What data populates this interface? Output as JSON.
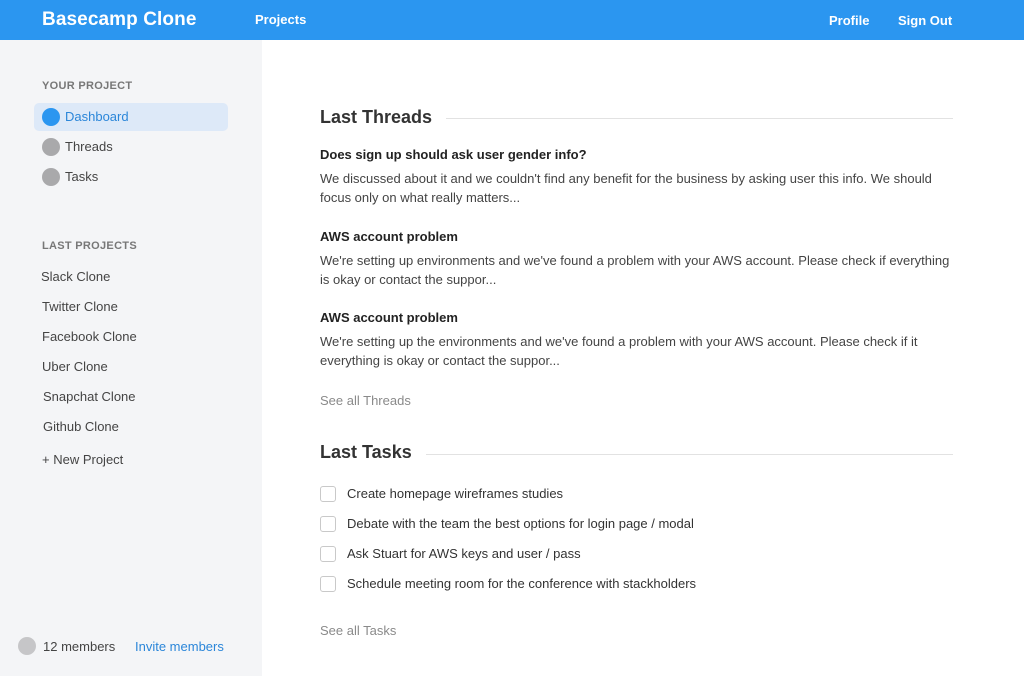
{
  "header": {
    "brand": "Basecamp Clone",
    "projects_label": "Projects",
    "profile_label": "Profile",
    "signout_label": "Sign Out",
    "accent_color": "#2b96f0"
  },
  "sidebar": {
    "your_project_heading": "YOUR PROJECT",
    "nav": [
      {
        "label": "Dashboard",
        "active": true
      },
      {
        "label": "Threads",
        "active": false
      },
      {
        "label": "Tasks",
        "active": false
      }
    ],
    "last_projects_heading": "LAST PROJECTS",
    "projects": [
      "Slack Clone",
      "Twitter Clone",
      "Facebook Clone",
      "Uber Clone",
      "Snapchat Clone",
      "Github Clone"
    ],
    "new_project_label": "+ New Project",
    "members_count": "12 members",
    "invite_label": "Invite members"
  },
  "threads": {
    "title": "Last Threads",
    "items": [
      {
        "title": "Does sign up should ask user gender info?",
        "body": "We discussed about it and we couldn't find any benefit for the business by asking user this info. We should focus only on what really matters..."
      },
      {
        "title": "AWS account problem",
        "body": "We're setting up environments and we've found a problem with your AWS account. Please check if everything is okay or contact the suppor..."
      },
      {
        "title": "AWS account problem",
        "body": "We're setting up the environments and we've found a problem with your AWS account. Please check if it everything is okay or contact the suppor..."
      }
    ],
    "see_all_label": "See all Threads"
  },
  "tasks": {
    "title": "Last Tasks",
    "items": [
      {
        "label": "Create homepage wireframes studies",
        "checked": false
      },
      {
        "label": "Debate with the team the best options for login page / modal",
        "checked": false
      },
      {
        "label": "Ask Stuart for AWS keys and user / pass",
        "checked": false
      },
      {
        "label": "Schedule meeting room for the conference with stackholders",
        "checked": false
      }
    ],
    "see_all_label": "See all Tasks"
  }
}
